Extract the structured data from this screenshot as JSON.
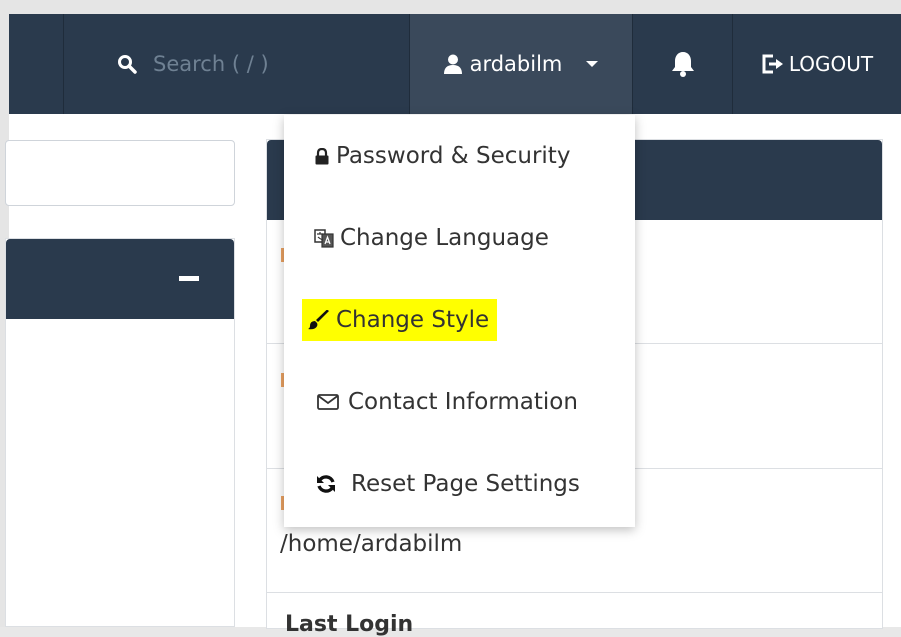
{
  "header": {
    "search_placeholder": "Search ( / )",
    "username": "ardabilm",
    "logout_label": "LOGOUT"
  },
  "user_menu": {
    "items": [
      {
        "label": "Password & Security",
        "icon": "lock-icon"
      },
      {
        "label": "Change Language",
        "icon": "language-icon"
      },
      {
        "label": "Change Style",
        "icon": "paintbrush-icon",
        "highlighted": true
      },
      {
        "label": "Contact Information",
        "icon": "envelope-icon"
      },
      {
        "label": "Reset Page Settings",
        "icon": "refresh-icon"
      }
    ]
  },
  "stats": {
    "home_directory": "/home/ardabilm",
    "last_login_label": "Last Login"
  },
  "colors": {
    "topbar": "#2a3a4d",
    "active_user_button": "#3a495b",
    "highlight": "#ffff00",
    "accent_orange": "#e9a161"
  }
}
